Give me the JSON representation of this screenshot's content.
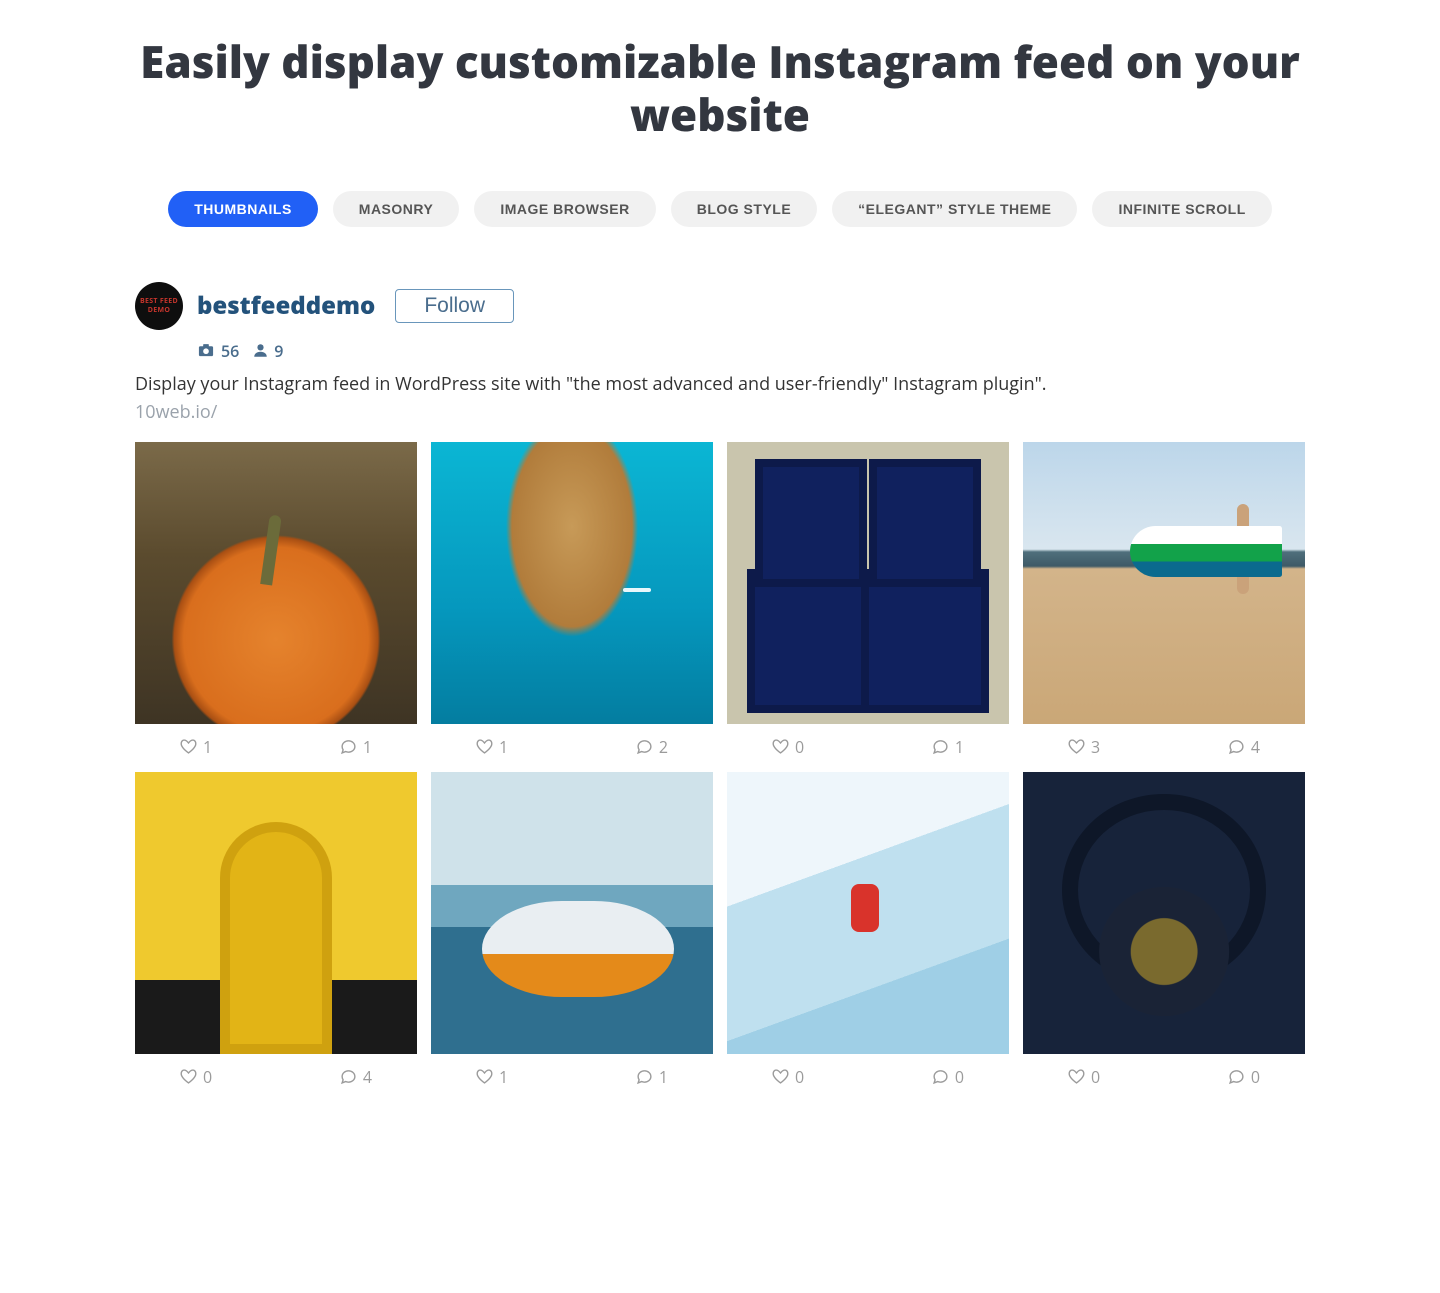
{
  "headline": "Easily display customizable Instagram feed on your website",
  "tabs": [
    {
      "label": "THUMBNAILS",
      "active": true
    },
    {
      "label": "MASONRY",
      "active": false
    },
    {
      "label": "IMAGE BROWSER",
      "active": false
    },
    {
      "label": "BLOG STYLE",
      "active": false
    },
    {
      "label": "“ELEGANT” STYLE THEME",
      "active": false
    },
    {
      "label": "INFINITE SCROLL",
      "active": false
    }
  ],
  "profile": {
    "avatar_text": "BEST FEED DEMO",
    "username": "bestfeeddemo",
    "follow_label": "Follow",
    "posts_count": "56",
    "followers_count": "9",
    "bio": "Display your Instagram feed in WordPress site with \"the most advanced and user-friendly\" Instagram plugin\".",
    "link": "10web.io/"
  },
  "grid": [
    {
      "img": "img-pumpkin",
      "likes": "1",
      "comments": "1"
    },
    {
      "img": "img-aerial",
      "likes": "1",
      "comments": "2"
    },
    {
      "img": "img-windows",
      "likes": "0",
      "comments": "1"
    },
    {
      "img": "img-surf",
      "likes": "3",
      "comments": "4"
    },
    {
      "img": "img-door",
      "likes": "0",
      "comments": "4"
    },
    {
      "img": "img-boat",
      "likes": "1",
      "comments": "1"
    },
    {
      "img": "img-ice",
      "likes": "0",
      "comments": "0"
    },
    {
      "img": "img-kettle",
      "likes": "0",
      "comments": "0"
    }
  ],
  "icons": {
    "camera": "camera-icon",
    "user": "user-icon",
    "heart": "heart-icon",
    "comment": "comment-icon"
  }
}
